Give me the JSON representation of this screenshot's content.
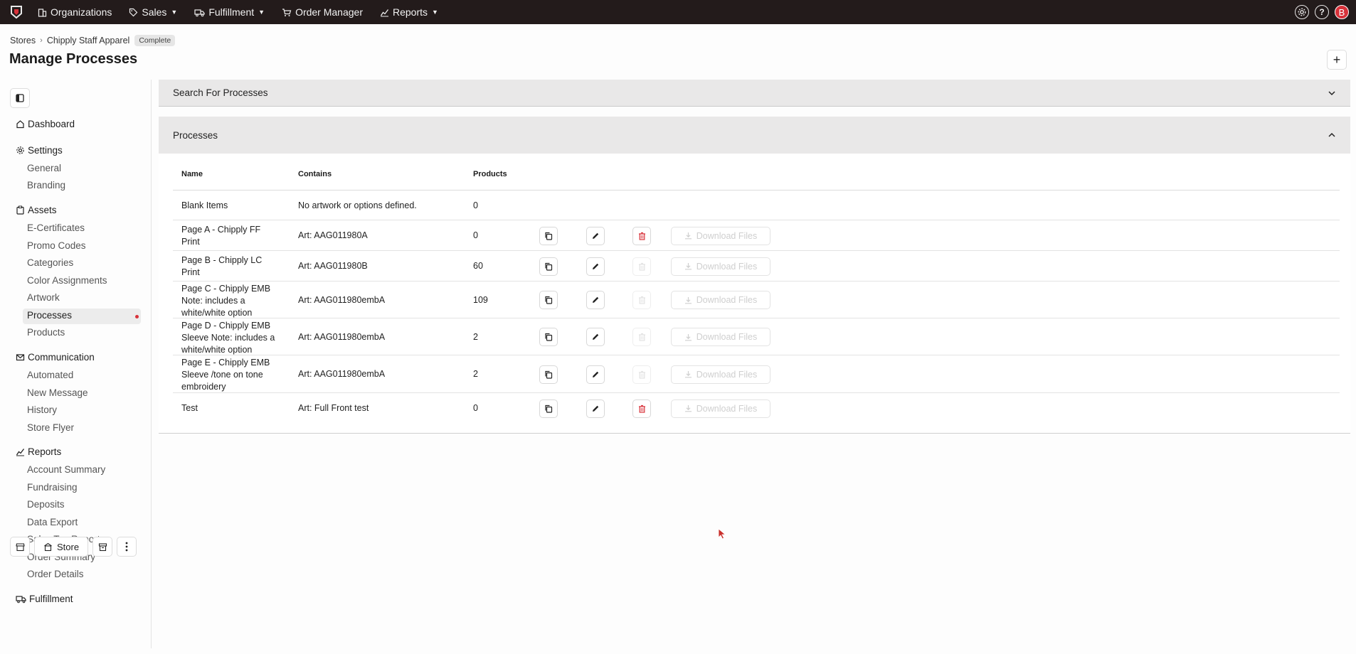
{
  "topnav": {
    "items": [
      {
        "label": "Organizations",
        "icon": "building-icon",
        "has_caret": false
      },
      {
        "label": "Sales",
        "icon": "tag-icon",
        "has_caret": true
      },
      {
        "label": "Fulfillment",
        "icon": "truck-icon",
        "has_caret": true
      },
      {
        "label": "Order Manager",
        "icon": "cart-icon",
        "has_caret": false
      },
      {
        "label": "Reports",
        "icon": "chart-icon",
        "has_caret": true
      }
    ],
    "help_label": "?",
    "avatar_initial": "B",
    "accent_color": "#d8323a",
    "bar_color": "#231b1b"
  },
  "breadcrumb": {
    "root": "Stores",
    "store": "Chipply Staff Apparel",
    "status": "Complete"
  },
  "page": {
    "title": "Manage Processes",
    "add_label": "+"
  },
  "sidebar": {
    "dashboard": "Dashboard",
    "settings": {
      "label": "Settings",
      "items": [
        "General",
        "Branding"
      ]
    },
    "assets": {
      "label": "Assets",
      "items": [
        "E-Certificates",
        "Promo Codes",
        "Categories",
        "Color Assignments",
        "Artwork",
        "Processes",
        "Products"
      ]
    },
    "communication": {
      "label": "Communication",
      "items": [
        "Automated",
        "New Message",
        "History",
        "Store Flyer"
      ]
    },
    "reports": {
      "label": "Reports",
      "items": [
        "Account Summary",
        "Fundraising",
        "Deposits",
        "Data Export",
        "Sales Tax Report",
        "Order Summary",
        "Order Details"
      ]
    },
    "fulfillment": "Fulfillment",
    "active_item": "Processes",
    "store_button": "Store"
  },
  "search_panel": {
    "title": "Search For Processes"
  },
  "processes_panel": {
    "title": "Processes",
    "columns": [
      "Name",
      "Contains",
      "Products"
    ],
    "download_label": "Download Files",
    "rows": [
      {
        "name": "Blank Items",
        "contains": "No artwork or options defined.",
        "products": "0",
        "actions": false
      },
      {
        "name": "Page A - Chipply FF Print",
        "contains": "Art: AAG011980A",
        "products": "0",
        "actions": true,
        "delete_enabled": true
      },
      {
        "name": "Page B - Chipply LC Print",
        "contains": "Art: AAG011980B",
        "products": "60",
        "actions": true,
        "delete_enabled": false
      },
      {
        "name": "Page C - Chipply EMB Note: includes a white/white option",
        "contains": "Art: AAG011980embA",
        "products": "109",
        "actions": true,
        "delete_enabled": false
      },
      {
        "name": "Page D - Chipply EMB Sleeve Note: includes a white/white option",
        "contains": "Art: AAG011980embA",
        "products": "2",
        "actions": true,
        "delete_enabled": false
      },
      {
        "name": "Page E - Chipply EMB Sleeve /tone on tone embroidery",
        "contains": "Art: AAG011980embA",
        "products": "2",
        "actions": true,
        "delete_enabled": false
      },
      {
        "name": "Test",
        "contains": "Art: Full Front test",
        "products": "0",
        "actions": true,
        "delete_enabled": true
      }
    ]
  }
}
